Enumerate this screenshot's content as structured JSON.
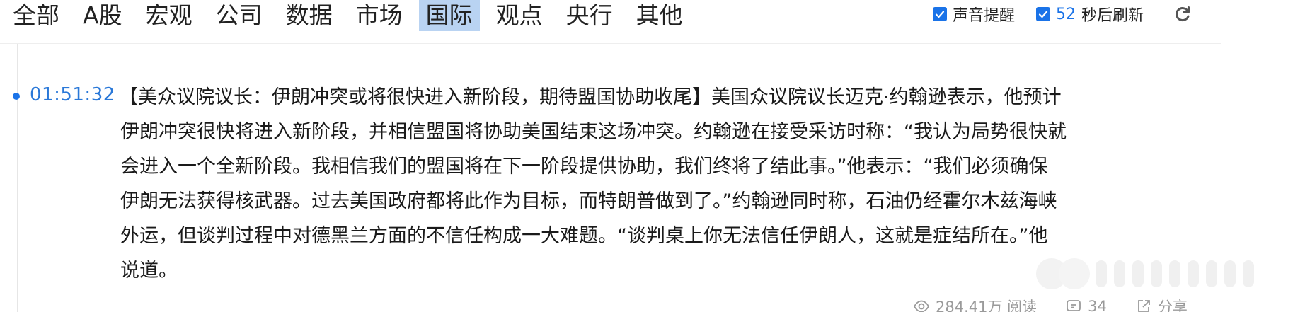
{
  "tabs": [
    {
      "label": "全部",
      "active": false
    },
    {
      "label": "A股",
      "active": false
    },
    {
      "label": "宏观",
      "active": false
    },
    {
      "label": "公司",
      "active": false
    },
    {
      "label": "数据",
      "active": false
    },
    {
      "label": "市场",
      "active": false
    },
    {
      "label": "国际",
      "active": true
    },
    {
      "label": "观点",
      "active": false
    },
    {
      "label": "央行",
      "active": false
    },
    {
      "label": "其他",
      "active": false
    }
  ],
  "controls": {
    "sound_alert": {
      "label": "声音提醒",
      "checked": true
    },
    "auto_refresh": {
      "seconds": "52",
      "label": "秒后刷新",
      "checked": true
    },
    "refresh_icon": "refresh-icon"
  },
  "news_item": {
    "time": "01:51:32",
    "lines": [
      "【美众议院议长：伊朗冲突或将很快进入新阶段，期待盟国协助收尾】美国众议院议长迈克·约翰逊表示，他预计",
      "伊朗冲突很快将进入新阶段，并相信盟国将协助美国结束这场冲突。约翰逊在接受采访时称：“我认为局势很快就",
      "会进入一个全新阶段。我相信我们的盟国将在下一阶段提供协助，我们终将了结此事。”他表示：“我们必须确保",
      "伊朗无法获得核武器。过去美国政府都将此作为目标，而特朗普做到了。”约翰逊同时称，石油仍经霍尔木兹海峡",
      "外运，但谈判过程中对德黑兰方面的不信任构成一大难题。“谈判桌上你无法信任伊朗人，这就是症结所在。”他",
      "说道。"
    ],
    "stats": {
      "views": "284.41万 阅读",
      "comments": "34",
      "share": "分享"
    }
  },
  "colors": {
    "accent": "#1a73e8",
    "time_text": "#2a78d8",
    "active_tab_bg": "#b9d3f2",
    "muted": "#9a9a9a"
  }
}
